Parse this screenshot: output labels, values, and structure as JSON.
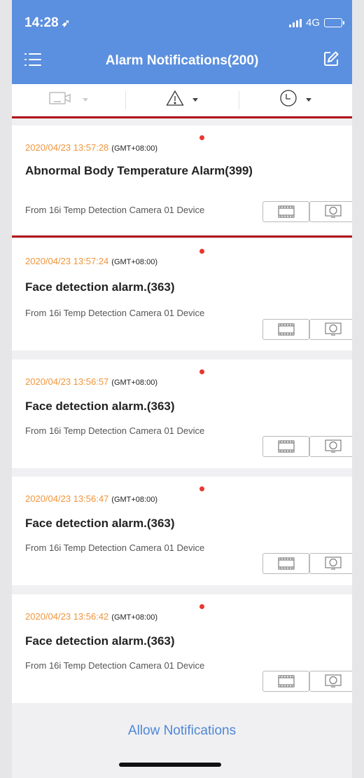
{
  "status_bar": {
    "time": "14:28",
    "network": "4G"
  },
  "header": {
    "title": "Alarm Notifications(200)"
  },
  "filters": [
    {
      "name": "camera-filter",
      "icon": "camera-icon"
    },
    {
      "name": "alarm-type-filter",
      "icon": "warning-icon"
    },
    {
      "name": "time-filter",
      "icon": "clock-icon"
    }
  ],
  "notifications": [
    {
      "datetime": "2020/04/23 13:57:28",
      "timezone": "(GMT+08:00)",
      "title": "Abnormal Body Temperature Alarm(399)",
      "source": "From 16i Temp Detection Camera 01 Device",
      "unread": true
    },
    {
      "datetime": "2020/04/23 13:57:24",
      "timezone": "(GMT+08:00)",
      "title": "Face detection alarm.(363)",
      "source": "From 16i Temp Detection Camera 01 Device",
      "unread": true
    },
    {
      "datetime": "2020/04/23 13:56:57",
      "timezone": "(GMT+08:00)",
      "title": "Face detection alarm.(363)",
      "source": "From 16i Temp Detection Camera 01 Device",
      "unread": true
    },
    {
      "datetime": "2020/04/23 13:56:47",
      "timezone": "(GMT+08:00)",
      "title": "Face detection alarm.(363)",
      "source": "From 16i Temp Detection Camera 01 Device",
      "unread": true
    },
    {
      "datetime": "2020/04/23 13:56:42",
      "timezone": "(GMT+08:00)",
      "title": "Face detection alarm.(363)",
      "source": "From 16i Temp Detection Camera 01 Device",
      "unread": true
    }
  ],
  "footer": {
    "allow_label": "Allow Notifications"
  },
  "colors": {
    "header": "#5b8fdf",
    "timestamp": "#f0953b",
    "unread_dot": "#e8372f",
    "highlight": "#b3131b",
    "link": "#4f87d6"
  }
}
